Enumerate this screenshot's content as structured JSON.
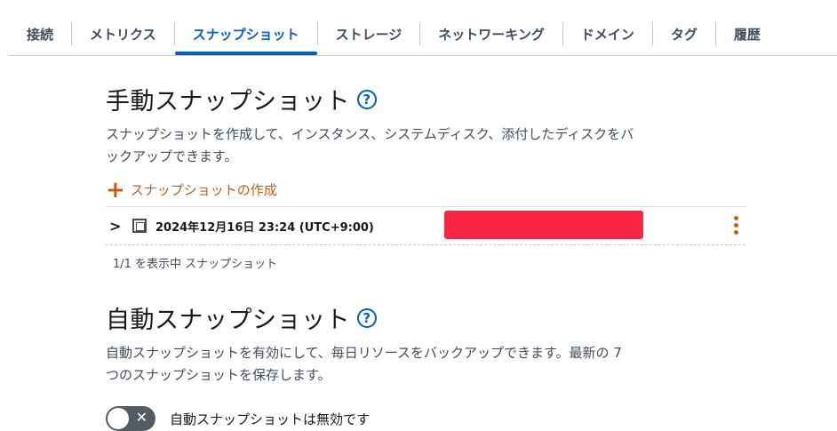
{
  "tabs": [
    {
      "label": "接続"
    },
    {
      "label": "メトリクス"
    },
    {
      "label": "スナップショット",
      "active": true
    },
    {
      "label": "ストレージ"
    },
    {
      "label": "ネットワーキング"
    },
    {
      "label": "ドメイン"
    },
    {
      "label": "タグ"
    },
    {
      "label": "履歴"
    }
  ],
  "manual": {
    "title": "手動スナップショット",
    "help": "?",
    "description": "スナップショットを作成して、インスタンス、システムディスク、添付したディスクをバックアップできます。",
    "create_label": "スナップショットの作成",
    "snapshot": {
      "expand_icon": "chevron-right-icon",
      "label": "2024年12月16日 23:24 (UTC+9:00)"
    },
    "count_text": "1/1 を表示中 スナップショット"
  },
  "auto": {
    "title": "自動スナップショット",
    "help": "?",
    "description": "自動スナップショットを有効にして、毎日リソースをバックアップできます。最新の 7 つのスナップショットを保存します。",
    "toggle_label": "自動スナップショットは無効です",
    "toggle_state": "off"
  },
  "colors": {
    "accent_blue": "#0a5fb8",
    "action_orange": "#c45f14",
    "redaction": "#fa2543"
  }
}
